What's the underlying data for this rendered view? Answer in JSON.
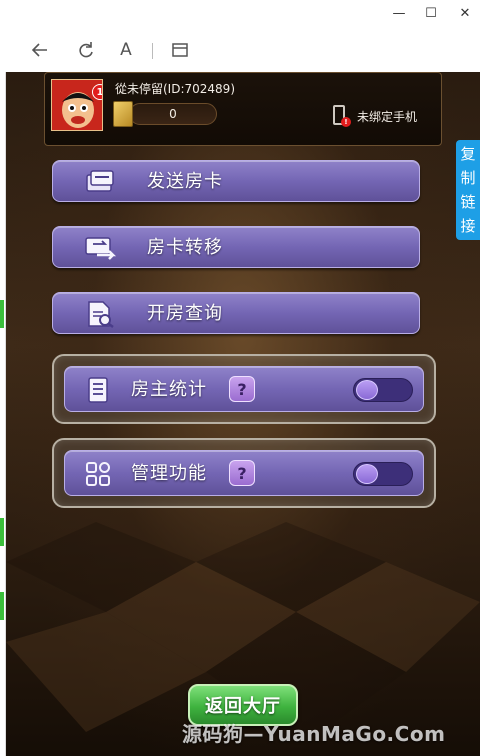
{
  "window": {
    "minimize_glyph": "—",
    "maximize_glyph": "☐",
    "close_glyph": "✕"
  },
  "toolbar": {
    "icons": [
      "back-arrow-icon",
      "refresh-icon",
      "text-size-icon",
      "window-icon"
    ],
    "text_size_glyph": "A"
  },
  "profile": {
    "name": "從未停留(ID:702489)",
    "avatar_badge": "1",
    "room_cards": "0",
    "phone_status": "未绑定手机"
  },
  "side_tab": {
    "label_chars": [
      "复",
      "制",
      "链",
      "接"
    ]
  },
  "menu": {
    "send_card": "发送房卡",
    "transfer_card": "房卡转移",
    "room_query": "开房查询"
  },
  "toggles": {
    "owner_stats": {
      "label": "房主统计",
      "help": "?",
      "enabled": false
    },
    "manage": {
      "label": "管理功能",
      "help": "?",
      "enabled": false
    }
  },
  "back_button": "返回大厅",
  "watermark": "源码狗—YuanMaGo.Com",
  "colors": {
    "button_purple": "#7466b4",
    "back_green": "#3fb33f",
    "side_tab_blue": "#1e9fe6",
    "badge_red": "#e21c1c"
  }
}
